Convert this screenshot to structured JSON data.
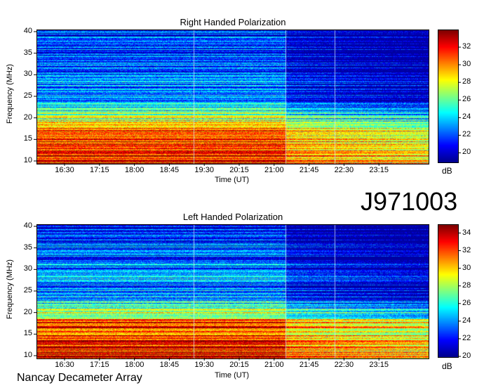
{
  "page_id": "J971003",
  "footer_label": "Nancay Decameter Array",
  "colors": {
    "scale": [
      "#00008f",
      "#0000ff",
      "#0080ff",
      "#00ffff",
      "#80ff80",
      "#ffff00",
      "#ff8000",
      "#ff0000",
      "#800000"
    ]
  },
  "chart_data": [
    {
      "type": "heatmap",
      "title": "Right Handed Polarization",
      "xlabel": "Time (UT)",
      "ylabel": "Frequency (MHz)",
      "x_tick_labels": [
        "16:30",
        "17:15",
        "18:00",
        "18:45",
        "19:30",
        "20:15",
        "21:00",
        "21:45",
        "22:30",
        "23:15"
      ],
      "y_tick_labels": [
        "10",
        "15",
        "20",
        "25",
        "30",
        "35",
        "40"
      ],
      "ylim": [
        10,
        40
      ],
      "colorbar": {
        "label": "dB",
        "range": [
          19,
          34
        ],
        "tick_labels": [
          "20",
          "22",
          "24",
          "26",
          "28",
          "30",
          "32"
        ]
      }
    },
    {
      "type": "heatmap",
      "title": "Left Handed Polarization",
      "xlabel": "Time (UT)",
      "ylabel": "Frequency (MHz)",
      "x_tick_labels": [
        "16:30",
        "17:15",
        "18:00",
        "18:45",
        "19:30",
        "20:15",
        "21:00",
        "21:45",
        "22:30",
        "23:15"
      ],
      "y_tick_labels": [
        "10",
        "15",
        "20",
        "25",
        "30",
        "35",
        "40"
      ],
      "ylim": [
        10,
        40
      ],
      "colorbar": {
        "label": "dB",
        "range": [
          20,
          35
        ],
        "tick_labels": [
          "20",
          "22",
          "24",
          "26",
          "28",
          "30",
          "32",
          "34"
        ]
      }
    }
  ]
}
